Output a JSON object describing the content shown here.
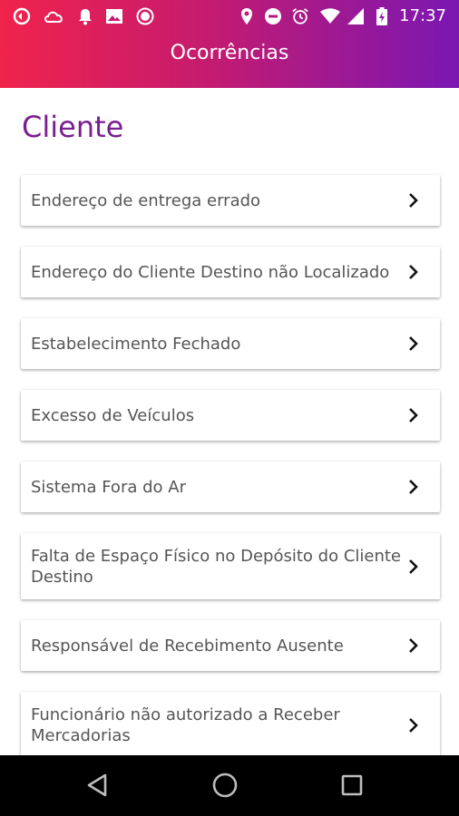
{
  "status_bar": {
    "time": "17:37",
    "left_icons": [
      "sync-icon",
      "cloud-icon",
      "bell-icon",
      "image-icon",
      "circle-icon"
    ],
    "right_icons": [
      "location-icon",
      "do-not-disturb-icon",
      "alarm-icon",
      "wifi-icon",
      "signal-icon",
      "battery-charging-icon"
    ]
  },
  "header": {
    "title": "Ocorrências"
  },
  "section": {
    "title": "Cliente"
  },
  "items": [
    {
      "label": "Endereço de entrega errado"
    },
    {
      "label": "Endereço do Cliente Destino não Localizado"
    },
    {
      "label": "Estabelecimento Fechado"
    },
    {
      "label": "Excesso de Veículos"
    },
    {
      "label": "Sistema Fora do Ar"
    },
    {
      "label": "Falta de Espaço Físico no Depósito do Cliente Destino"
    },
    {
      "label": "Responsável de Recebimento Ausente"
    },
    {
      "label": "Funcionário não autorizado a Receber Mercadorias"
    }
  ],
  "nav": {
    "buttons": [
      "back-icon",
      "home-icon",
      "recents-icon"
    ]
  },
  "colors": {
    "gradient_start": "#f0234c",
    "gradient_end": "#7a17b3",
    "section_title": "#7a1f8f"
  }
}
